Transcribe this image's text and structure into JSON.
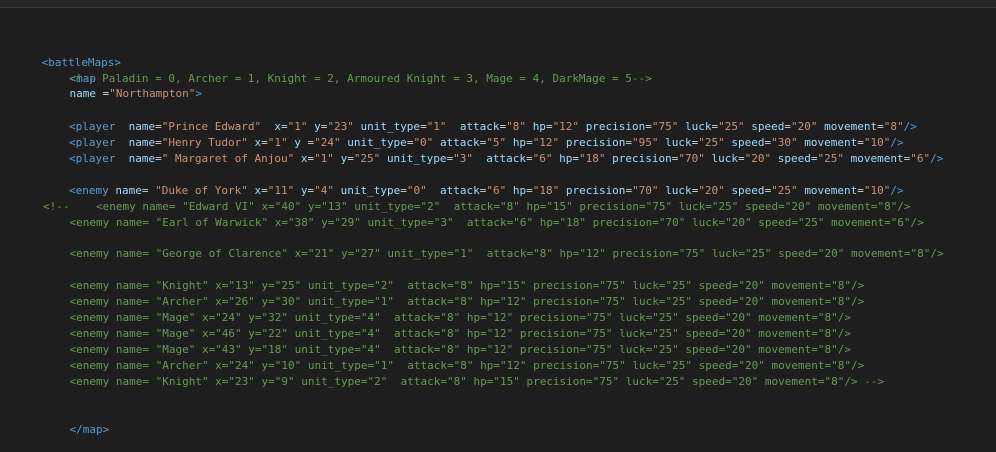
{
  "document": {
    "root_open": "<battleMaps>",
    "map_open_tag": "<map",
    "map_name_attr": "name",
    "map_name_eq": " =",
    "map_name_value": "\"Northampton\"",
    "map_close_bracket": ">",
    "legend_comment": "<!-- Paladin = 0, Archer = 1, Knight = 2, Armoured Knight = 3, Mage = 4, DarkMage = 5-->",
    "players": [
      {
        "name": "\"Prince Edward\"",
        "x": "\"1\"",
        "y": "\"23\"",
        "unit_type": "\"1\"",
        "attack": "\"8\"",
        "hp": "\"12\"",
        "precision": "\"75\"",
        "luck": "\"25\"",
        "speed": "\"20\"",
        "movement": "\"8\""
      },
      {
        "name": "\"Henry Tudor\"",
        "x": "\"1\"",
        "y": "\"24\"",
        "unit_type": "\"0\"",
        "attack": "\"5\"",
        "hp": "\"12\"",
        "precision": "\"95\"",
        "luck": "\"25\"",
        "speed": "\"30\"",
        "movement": "\"10\""
      },
      {
        "name": "\" Margaret of Anjou\"",
        "x": "\"1\"",
        "y": "\"25\"",
        "unit_type": "\"3\"",
        "attack": "\"6\"",
        "hp": "\"18\"",
        "precision": "\"70\"",
        "luck": "\"20\"",
        "speed": "\"25\"",
        "movement": "\"6\""
      }
    ],
    "enemy_york": {
      "name": "\"Duke of York\"",
      "x": "\"11\"",
      "y": "\"4\"",
      "unit_type": "\"0\"",
      "attack": "\"6\"",
      "hp": "\"18\"",
      "precision": "\"70\"",
      "luck": "\"20\"",
      "speed": "\"25\"",
      "movement": "\"10\""
    },
    "commented_lines": [
      "<!--    <enemy name= \"Edward VI\" x=\"40\" y=\"13\" unit_type=\"2\"  attack=\"8\" hp=\"15\" precision=\"75\" luck=\"25\" speed=\"20\" movement=\"8\"/>",
      "    <enemy name= \"Earl of Warwick\" x=\"38\" y=\"29\" unit_type=\"3\"  attack=\"6\" hp=\"18\" precision=\"70\" luck=\"20\" speed=\"25\" movement=\"6\"/>",
      "    <enemy name= \"George of Clarence\" x=\"21\" y=\"27\" unit_type=\"1\"  attack=\"8\" hp=\"12\" precision=\"75\" luck=\"25\" speed=\"20\" movement=\"8\"/>",
      "    <enemy name= \"Knight\" x=\"13\" y=\"25\" unit_type=\"2\"  attack=\"8\" hp=\"15\" precision=\"75\" luck=\"25\" speed=\"20\" movement=\"8\"/>",
      "    <enemy name= \"Archer\" x=\"26\" y=\"30\" unit_type=\"1\"  attack=\"8\" hp=\"12\" precision=\"75\" luck=\"25\" speed=\"20\" movement=\"8\"/>",
      "    <enemy name= \"Mage\" x=\"24\" y=\"32\" unit_type=\"4\"  attack=\"8\" hp=\"12\" precision=\"75\" luck=\"25\" speed=\"20\" movement=\"8\"/>",
      "    <enemy name= \"Mage\" x=\"46\" y=\"22\" unit_type=\"4\"  attack=\"8\" hp=\"12\" precision=\"75\" luck=\"25\" speed=\"20\" movement=\"8\"/>",
      "    <enemy name= \"Mage\" x=\"43\" y=\"18\" unit_type=\"4\"  attack=\"8\" hp=\"12\" precision=\"75\" luck=\"25\" speed=\"20\" movement=\"8\"/>",
      "    <enemy name= \"Archer\" x=\"24\" y=\"10\" unit_type=\"1\"  attack=\"8\" hp=\"12\" precision=\"75\" luck=\"25\" speed=\"20\" movement=\"8\"/>",
      "    <enemy name= \"Knight\" x=\"23\" y=\"9\" unit_type=\"2\"  attack=\"8\" hp=\"15\" precision=\"75\" luck=\"25\" speed=\"20\" movement=\"8\"/> -->"
    ],
    "map_close": "</map>"
  },
  "colors": {
    "background": "#1e1e1e",
    "tag": "#569cd6",
    "attribute": "#9cdcfe",
    "string": "#ce9178",
    "comment": "#6a9955",
    "plain": "#d4d4d4"
  }
}
